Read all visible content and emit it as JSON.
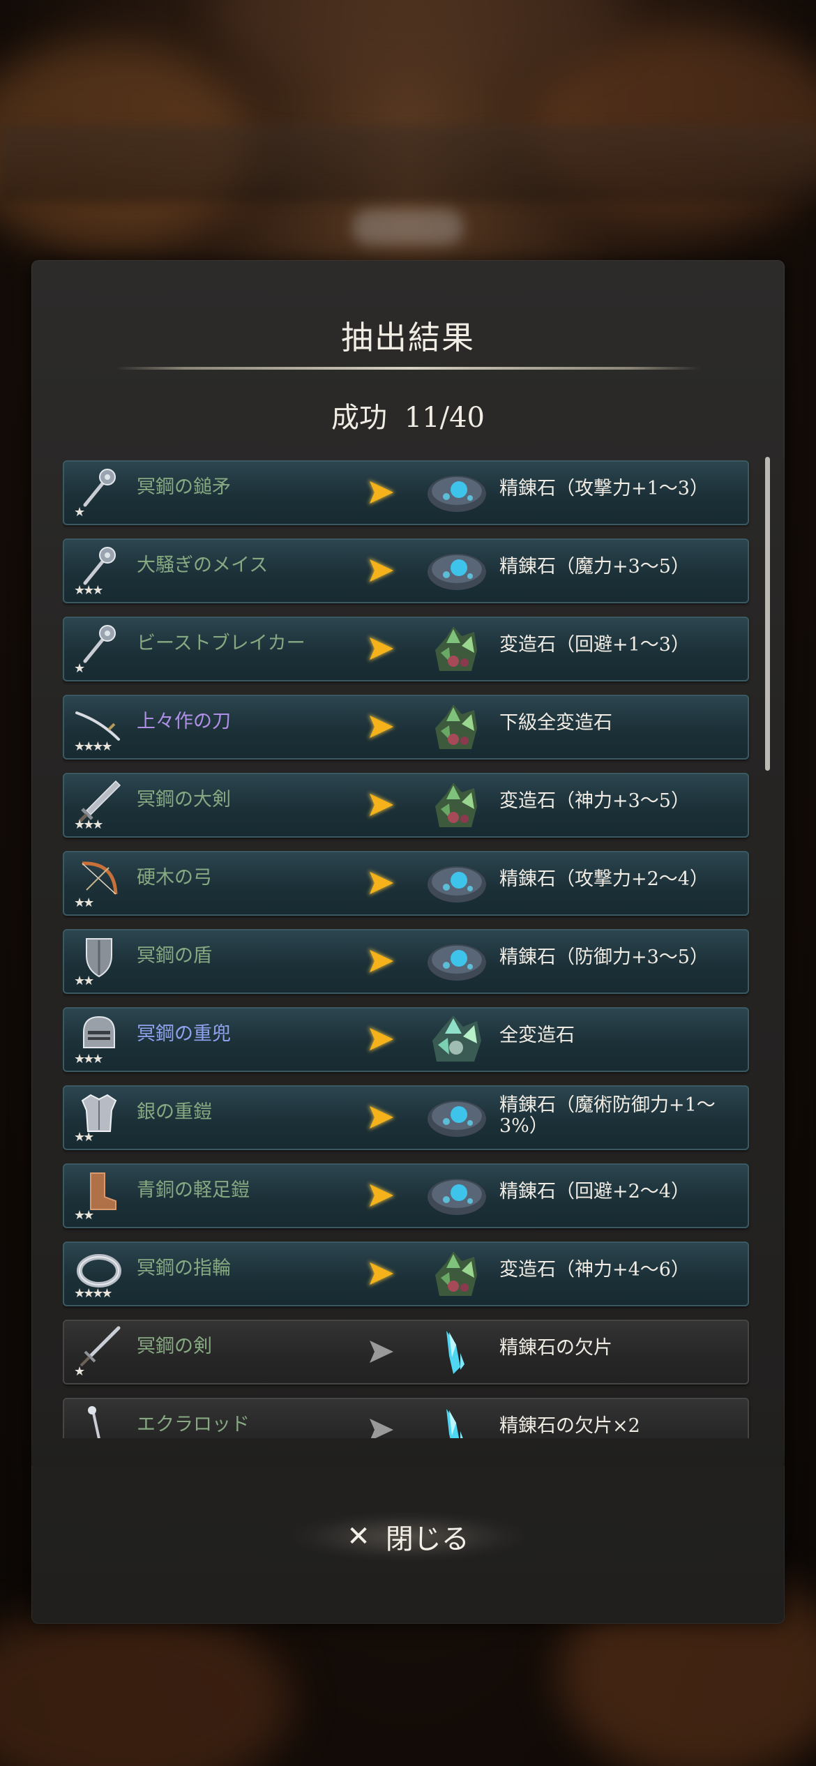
{
  "dialog": {
    "title": "抽出結果",
    "success_label": "成功",
    "success_count": "11/40",
    "close_label": "閉じる"
  },
  "rows": [
    {
      "name": "冥鋼の鎚矛",
      "stars": "★",
      "icon": "mace-icon",
      "name_color": "green",
      "success": true,
      "stone": "refining-stone-icon",
      "result": "精錬石（攻撃力+1～3）"
    },
    {
      "name": "大騒ぎのメイス",
      "stars": "★★★",
      "icon": "mace-icon",
      "name_color": "green",
      "success": true,
      "stone": "refining-stone-icon",
      "result": "精錬石（魔力+3～5）"
    },
    {
      "name": "ビーストブレイカー",
      "stars": "★",
      "icon": "mace-icon",
      "name_color": "green",
      "success": true,
      "stone": "alteration-stone-icon",
      "result": "変造石（回避+1～3）"
    },
    {
      "name": "上々作の刀",
      "stars": "★★★★",
      "icon": "katana-icon",
      "name_color": "purple",
      "success": true,
      "stone": "alteration-stone-icon",
      "result": "下級全変造石"
    },
    {
      "name": "冥鋼の大剣",
      "stars": "★★★",
      "icon": "greatsword-icon",
      "name_color": "green",
      "success": true,
      "stone": "alteration-stone-icon",
      "result": "変造石（神力+3～5）"
    },
    {
      "name": "硬木の弓",
      "stars": "★★",
      "icon": "bow-icon",
      "name_color": "green",
      "success": true,
      "stone": "refining-stone-icon",
      "result": "精錬石（攻撃力+2～4）"
    },
    {
      "name": "冥鋼の盾",
      "stars": "★★",
      "icon": "shield-icon",
      "name_color": "green",
      "success": true,
      "stone": "refining-stone-icon",
      "result": "精錬石（防御力+3～5）"
    },
    {
      "name": "冥鋼の重兜",
      "stars": "★★★",
      "icon": "helmet-icon",
      "name_color": "blue",
      "success": true,
      "stone": "full-alteration-stone-icon",
      "result": "全変造石"
    },
    {
      "name": "銀の重鎧",
      "stars": "★★",
      "icon": "armor-icon",
      "name_color": "green",
      "success": true,
      "stone": "refining-stone-icon",
      "result": "精錬石（魔術防御力+1～3%）"
    },
    {
      "name": "青銅の軽足鎧",
      "stars": "★★",
      "icon": "boots-icon",
      "name_color": "green",
      "success": true,
      "stone": "refining-stone-icon",
      "result": "精錬石（回避+2～4）"
    },
    {
      "name": "冥鋼の指輪",
      "stars": "★★★★",
      "icon": "ring-icon",
      "name_color": "green",
      "success": true,
      "stone": "alteration-stone-icon",
      "result": "変造石（神力+4～6）"
    },
    {
      "name": "冥鋼の剣",
      "stars": "★",
      "icon": "sword-icon",
      "name_color": "green",
      "success": false,
      "stone": "refining-shard-icon",
      "result": "精錬石の欠片"
    },
    {
      "name": "エクラロッド",
      "stars": "",
      "icon": "rod-icon",
      "name_color": "green",
      "success": false,
      "stone": "refining-shard-icon",
      "result": "精錬石の欠片×2"
    }
  ],
  "colors": {
    "success_arrow": "#f6b21a",
    "fail_arrow": "#9a9a9a",
    "name_green": "#86a982",
    "name_purple": "#b08fe6",
    "name_blue": "#8ea2ee"
  }
}
